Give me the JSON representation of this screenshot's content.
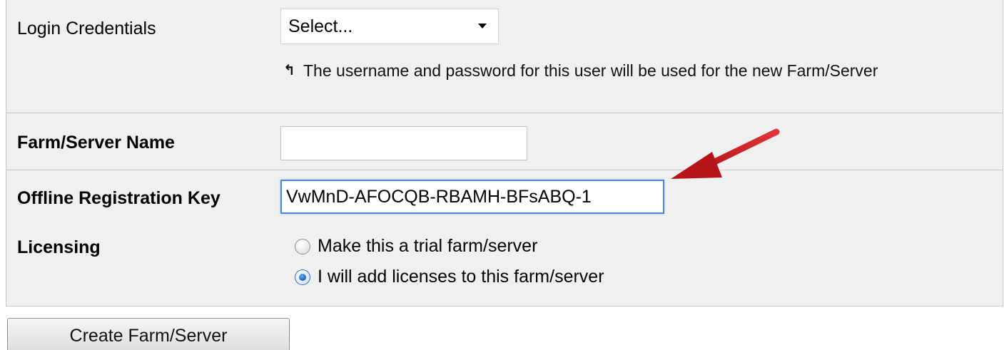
{
  "form": {
    "login_credentials": {
      "label": "Login Credentials",
      "selected": "Select..."
    },
    "hint_icon": "up-arrow-icon",
    "hint_text": "The username and password for this user will be used for the new Farm/Server",
    "farm_server_name": {
      "label": "Farm/Server Name",
      "value": ""
    },
    "offline_registration_key": {
      "label": "Offline Registration Key",
      "value": "VwMnD-AFOCQB-RBAMH-BFsABQ-1"
    },
    "licensing": {
      "label": "Licensing",
      "options": [
        {
          "label": "Make this a trial farm/server",
          "checked": false
        },
        {
          "label": "I will add licenses to this farm/server",
          "checked": true
        }
      ]
    },
    "submit_label": "Create Farm/Server"
  },
  "colors": {
    "panel_bg": "#f0f0f0",
    "annotation_arrow": "#c0151a",
    "focus_border": "#4a8ad0"
  }
}
